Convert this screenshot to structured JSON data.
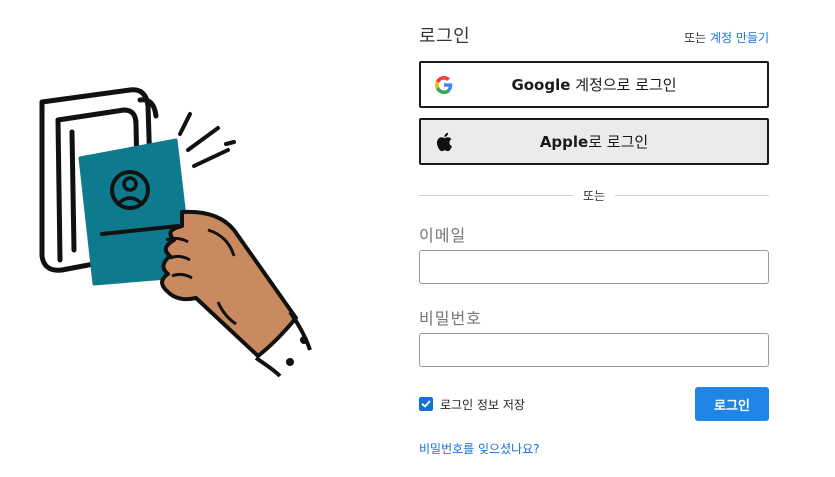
{
  "login": {
    "title": "로그인",
    "signup_prefix": "또는",
    "signup_link": "계정 만들기",
    "google_brand": "Google",
    "google_suffix": " 계정으로 로그인",
    "apple_brand": "Apple",
    "apple_suffix": "로 로그인",
    "divider": "또는",
    "email_label": "이메일",
    "email_value": "",
    "password_label": "비밀번호",
    "password_value": "",
    "remember_label": "로그인 정보 저장",
    "remember_checked": true,
    "login_button": "로그인",
    "forgot_link": "비밀번호를 잊으셨나요?"
  },
  "colors": {
    "link": "#1672d6",
    "primary_button": "#1f86e8",
    "card": "#0e7a8e",
    "hand": "#c98a5f"
  },
  "icons": [
    "google-icon",
    "apple-icon",
    "check-icon"
  ]
}
